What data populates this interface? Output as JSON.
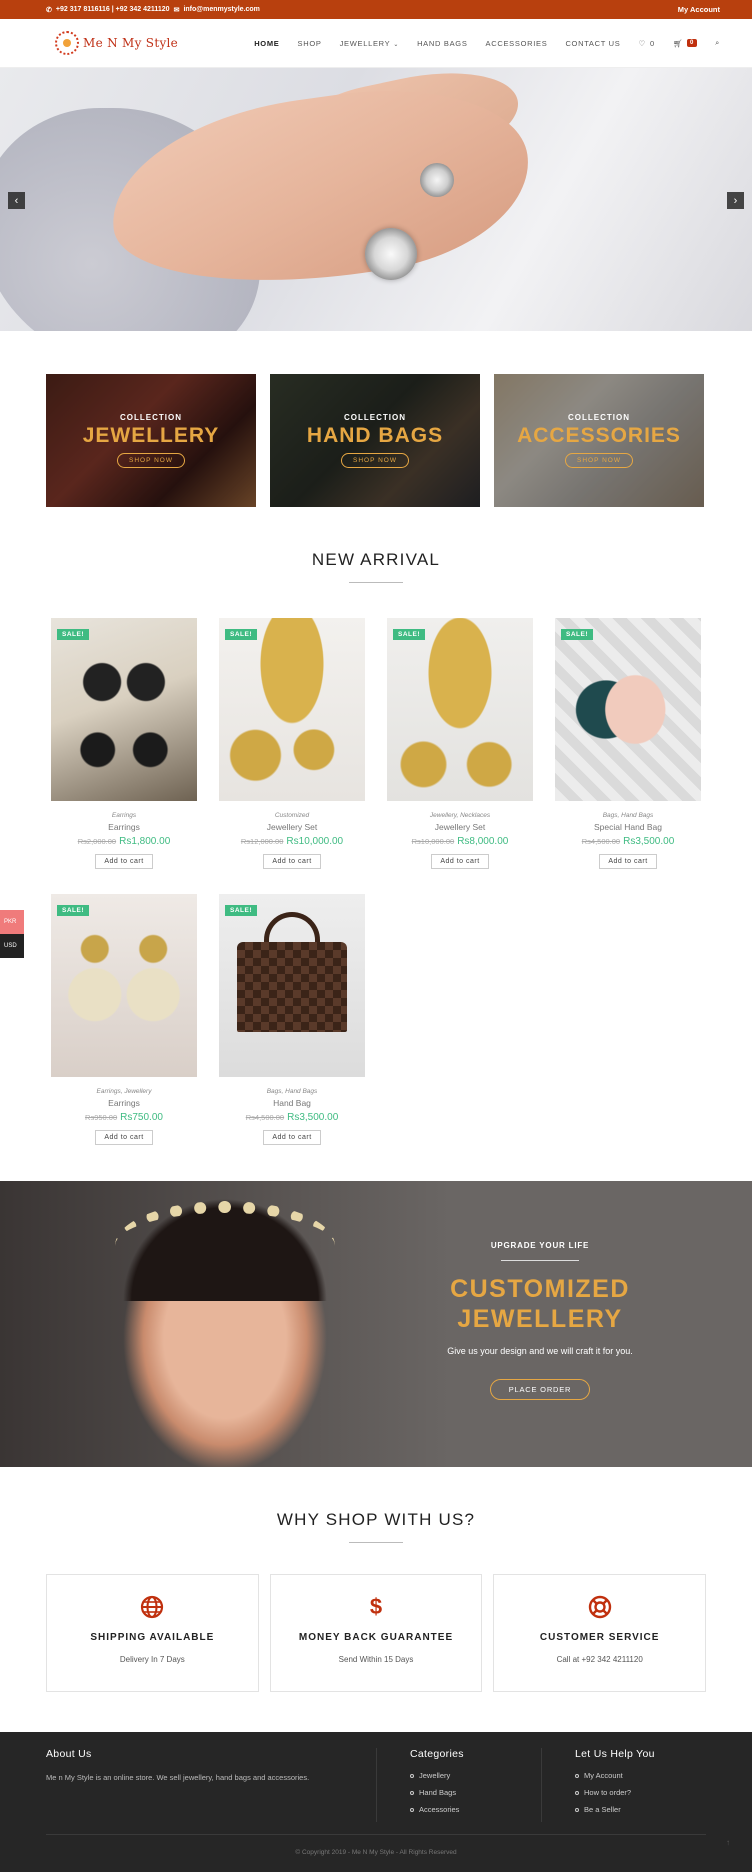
{
  "topbar": {
    "phone_icon": "phone-icon",
    "phones": "+92 317 8116116 | +92 342 4211120",
    "mail_icon": "mail-icon",
    "email": "info@menmystyle.com",
    "account": "My Account"
  },
  "header": {
    "logo_text": "Me N My Style",
    "nav": [
      "HOME",
      "SHOP",
      "JEWELLERY",
      "HAND BAGS",
      "ACCESSORIES",
      "CONTACT US"
    ],
    "wishlist_count": "0",
    "cart_count": "0"
  },
  "hero": {
    "prev": "‹",
    "next": "›"
  },
  "collections": [
    {
      "kicker": "COLLECTION",
      "title": "JEWELLERY",
      "button": "SHOP NOW"
    },
    {
      "kicker": "COLLECTION",
      "title": "HAND BAGS",
      "button": "SHOP NOW"
    },
    {
      "kicker": "COLLECTION",
      "title": "ACCESSORIES",
      "button": "SHOP NOW"
    }
  ],
  "new_arrival": {
    "title": "NEW ARRIVAL",
    "sale_badge": "SALE!",
    "add_to_cart": "Add to cart",
    "products": [
      {
        "cats": "Earrings",
        "name": "Earrings",
        "old": "Rs2,000.00",
        "new": "Rs1,800.00"
      },
      {
        "cats": "Customized",
        "name": "Jewellery Set",
        "old": "Rs12,000.00",
        "new": "Rs10,000.00"
      },
      {
        "cats": "Jewellery, Necklaces",
        "name": "Jewellery Set",
        "old": "Rs10,000.00",
        "new": "Rs8,000.00"
      },
      {
        "cats": "Bags, Hand Bags",
        "name": "Special Hand Bag",
        "old": "Rs4,500.00",
        "new": "Rs3,500.00"
      },
      {
        "cats": "Earrings, Jewellery",
        "name": "Earrings",
        "old": "Rs950.00",
        "new": "Rs750.00"
      },
      {
        "cats": "Bags, Hand Bags",
        "name": "Hand Bag",
        "old": "Rs4,500.00",
        "new": "Rs3,500.00"
      }
    ]
  },
  "currency": {
    "pkr": "PKR",
    "usd": "USD"
  },
  "custom_banner": {
    "kicker": "UPGRADE YOUR LIFE",
    "headline_line1": "CUSTOMIZED",
    "headline_line2": "JEWELLERY",
    "desc": "Give us your design and we will craft it for you.",
    "button": "PLACE ORDER"
  },
  "why": {
    "title": "WHY SHOP WITH US?",
    "features": [
      {
        "icon": "globe-icon",
        "title": "SHIPPING AVAILABLE",
        "sub": "Delivery In 7 Days"
      },
      {
        "icon": "dollar-icon",
        "title": "MONEY BACK GUARANTEE",
        "sub": "Send Within 15 Days"
      },
      {
        "icon": "lifebuoy-icon",
        "title": "CUSTOMER SERVICE",
        "sub": "Call at +92 342 4211120"
      }
    ]
  },
  "footer": {
    "about_title": "About Us",
    "about_text": "Me n My Style is an online store. We sell jewellery, hand bags and accessories.",
    "cat_title": "Categories",
    "categories": [
      "Jewellery",
      "Hand Bags",
      "Accessories"
    ],
    "help_title": "Let Us Help You",
    "help": [
      "My Account",
      "How to order?",
      "Be a Seller"
    ],
    "copyright": "© Copyright 2019 - Me N My Style - All Rights Reserved"
  },
  "colors": {
    "brand": "#b8400e",
    "accent_gold": "#e6a743",
    "sale_green": "#3fbb82",
    "footer_bg": "#262626"
  }
}
